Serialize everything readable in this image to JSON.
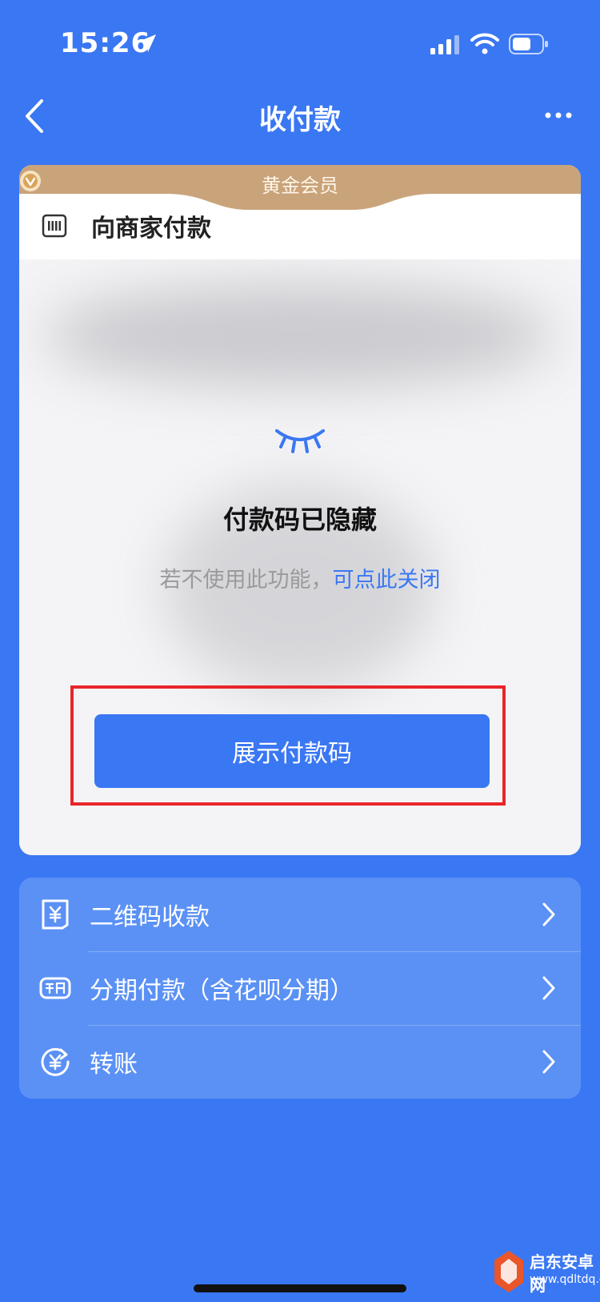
{
  "status_bar": {
    "time": "15:26"
  },
  "nav": {
    "title": "收付款"
  },
  "card": {
    "member_label": "黄金会员",
    "merchant_title": "向商家付款",
    "hidden_title": "付款码已隐藏",
    "hint_text": "若不使用此功能，",
    "hint_link": "可点此关闭",
    "show_button": "展示付款码"
  },
  "options": [
    {
      "label": "二维码收款",
      "icon": "qr-yuan-icon"
    },
    {
      "label": "分期付款（含花呗分期）",
      "icon": "installment-icon"
    },
    {
      "label": "转账",
      "icon": "transfer-icon"
    }
  ],
  "watermark": {
    "name": "启东安卓网",
    "url": "www.qdltdq.com"
  },
  "colors": {
    "background": "#3a77f3",
    "accent": "#3a77f3",
    "member_gold": "#c9a37a",
    "highlight": "#e8262a"
  }
}
